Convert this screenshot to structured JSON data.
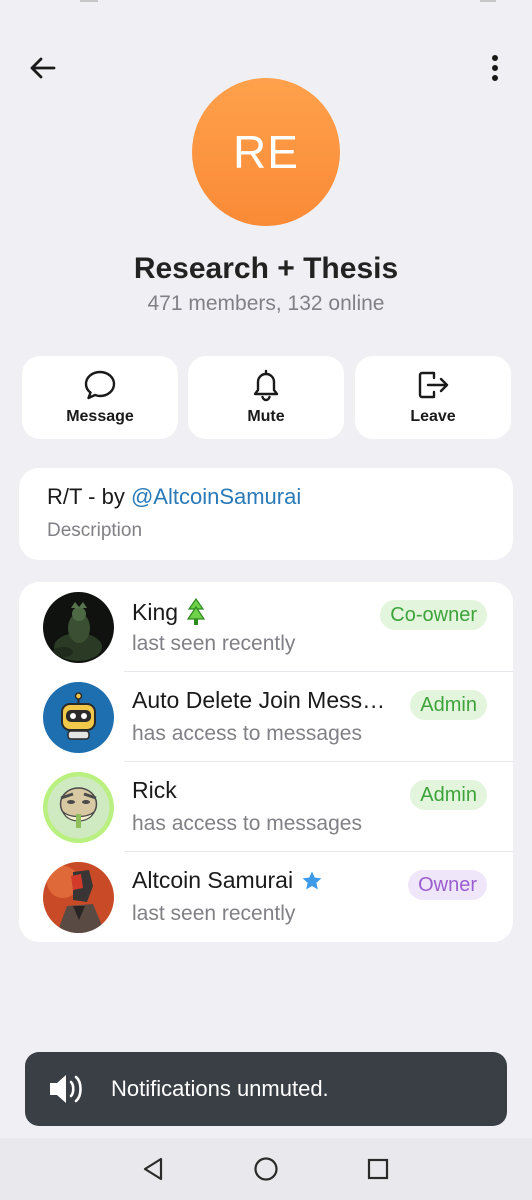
{
  "header": {
    "back_icon": "arrow-left-icon",
    "menu_icon": "more-vertical-icon"
  },
  "group": {
    "initials": "RE",
    "title": "Research + Thesis",
    "subtitle": "471 members, 132 online",
    "avatar_colors": [
      "#ffa14c",
      "#fa8a36"
    ]
  },
  "actions": [
    {
      "label": "Message",
      "icon": "chat-bubble-icon"
    },
    {
      "label": "Mute",
      "icon": "bell-icon"
    },
    {
      "label": "Leave",
      "icon": "logout-icon"
    }
  ],
  "description": {
    "prefix": "R/T - by ",
    "link": "@AltcoinSamurai",
    "label": "Description"
  },
  "members": [
    {
      "name": "King",
      "status": "last seen recently",
      "role": "Co-owner",
      "badge": "green-tree-badge-icon"
    },
    {
      "name": "Auto Delete Join Mess…",
      "status": "has access to messages",
      "role": "Admin"
    },
    {
      "name": "Rick",
      "status": "has access to messages",
      "role": "Admin"
    },
    {
      "name": "Altcoin Samurai",
      "status": "last seen recently",
      "role": "Owner",
      "badge": "blue-star-icon"
    }
  ],
  "toast": {
    "icon": "speaker-icon",
    "message": "Notifications unmuted."
  },
  "navbar": {
    "back": "nav-back-triangle-icon",
    "home": "nav-home-circle-icon",
    "recents": "nav-recents-square-icon"
  },
  "colors": {
    "link": "#2a7ab8",
    "role_green": "#3da33a",
    "role_purple": "#9a5ed0",
    "toast_bg": "#3a3f46"
  }
}
